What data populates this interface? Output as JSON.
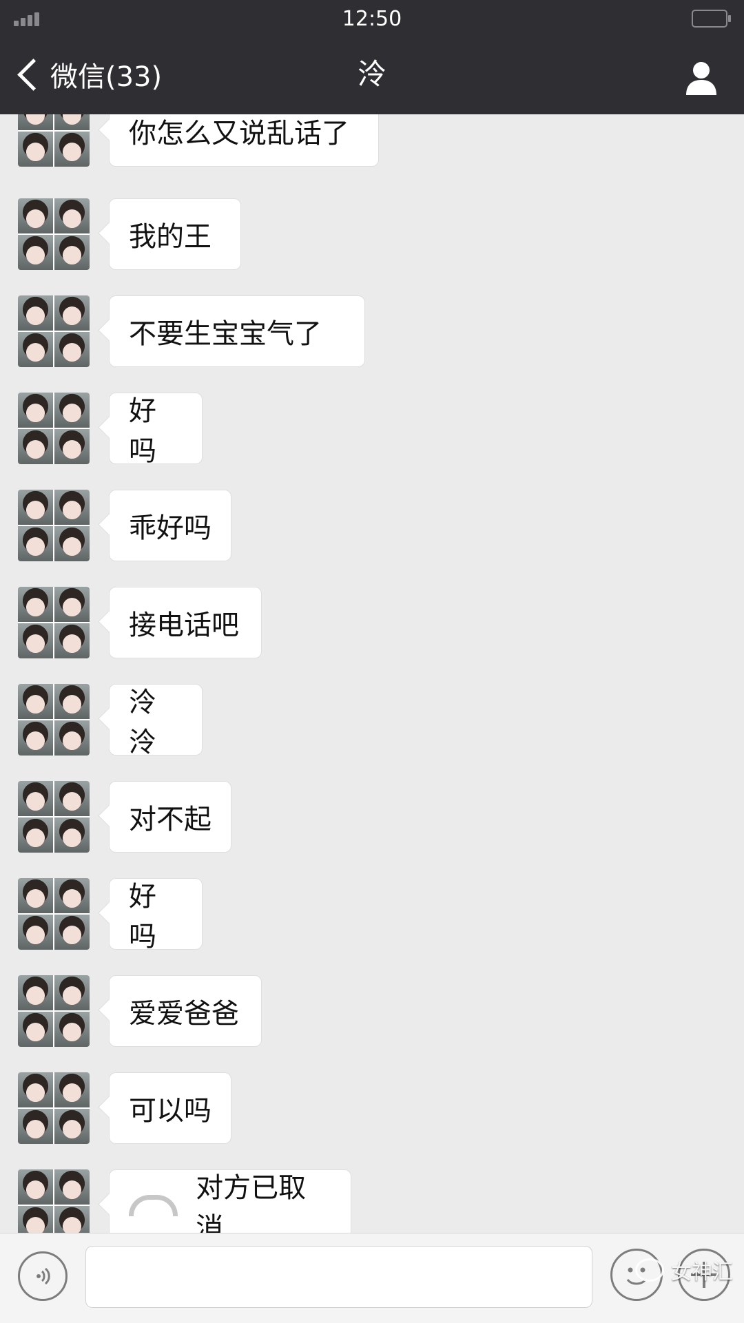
{
  "status_bar": {
    "time": "12:50"
  },
  "nav": {
    "back_label": "微信(33)",
    "title": "泠"
  },
  "messages": [
    {
      "text": "你怎么又说乱话了"
    },
    {
      "text": "我的王"
    },
    {
      "text": "不要生宝宝气了"
    },
    {
      "text": "好吗"
    },
    {
      "text": "乖好吗"
    },
    {
      "text": "接电话吧"
    },
    {
      "text": "泠泠"
    },
    {
      "text": "对不起"
    },
    {
      "text": "好吗"
    },
    {
      "text": "爱爱爸爸"
    },
    {
      "text": "可以吗"
    },
    {
      "text": "对方已取消",
      "icon": "phone-call-icon"
    }
  ],
  "watermark": {
    "text": "女神汇"
  }
}
